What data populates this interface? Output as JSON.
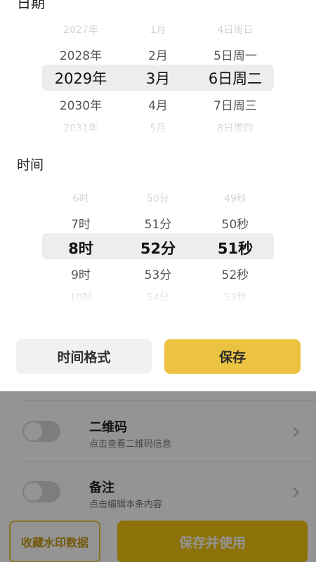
{
  "sheet": {
    "date_section_label": "日期",
    "date_picker": {
      "years": [
        "2027年",
        "2028年",
        "2029年",
        "2030年",
        "2031年"
      ],
      "months": [
        "1月",
        "2月",
        "3月",
        "4月",
        "5月"
      ],
      "days": [
        "4日周日",
        "5日周一",
        "6日周二",
        "7日周三",
        "8日周四"
      ],
      "selected_index": 2
    },
    "time_section_label": "时间",
    "time_picker": {
      "hours": [
        "6时",
        "7时",
        "8时",
        "9时",
        "10时"
      ],
      "minutes": [
        "50分",
        "51分",
        "52分",
        "53分",
        "54分"
      ],
      "seconds": [
        "49秒",
        "50秒",
        "51秒",
        "52秒",
        "53秒"
      ],
      "selected_index": 2
    },
    "format_button": "时间格式",
    "save_button": "保存"
  },
  "background_page": {
    "items": [
      {
        "title": "二维码",
        "subtitle": "点击查看二维码信息",
        "enabled": false
      },
      {
        "title": "备注",
        "subtitle": "点击编辑本条内容",
        "enabled": false
      }
    ],
    "favorite_button": "收藏水印数据",
    "save_and_use_button": "保存并使用"
  },
  "colors": {
    "accent": "#ecc340",
    "accent_strong": "#f1c40f",
    "selected_band": "#ededed"
  }
}
